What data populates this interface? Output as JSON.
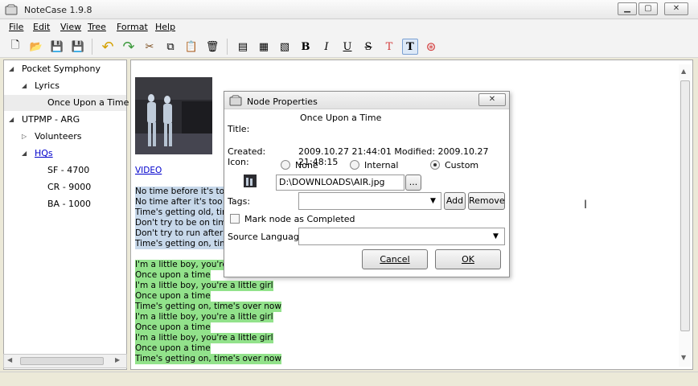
{
  "window": {
    "title": "NoteCase 1.9.8",
    "controls": {
      "minimize": "▁",
      "maximize": "▢",
      "close": "✕"
    }
  },
  "menubar": {
    "items": [
      {
        "label": "File"
      },
      {
        "label": "Edit"
      },
      {
        "label": "View"
      },
      {
        "label": "Tree"
      },
      {
        "label": "Format"
      },
      {
        "label": "Help"
      }
    ]
  },
  "toolbar": {
    "buttons": [
      {
        "icon": "new-document-icon",
        "glyph": "🗋"
      },
      {
        "icon": "open-folder-icon",
        "glyph": "📂"
      },
      {
        "icon": "save-icon",
        "glyph": "💾"
      },
      {
        "icon": "save-as-icon",
        "glyph": "💾"
      },
      {
        "icon": "undo-icon",
        "glyph": "↶"
      },
      {
        "icon": "redo-icon",
        "glyph": "↷"
      },
      {
        "icon": "cut-icon",
        "glyph": "✂"
      },
      {
        "icon": "copy-icon",
        "glyph": "⧉"
      },
      {
        "icon": "paste-icon",
        "glyph": "📋"
      },
      {
        "icon": "delete-icon",
        "glyph": "🗑"
      },
      {
        "icon": "insert-node-icon",
        "glyph": "▤"
      },
      {
        "icon": "insert-child-node-icon",
        "glyph": "▦"
      },
      {
        "icon": "delete-node-icon",
        "glyph": "▧"
      },
      {
        "icon": "bold-icon",
        "glyph": "B"
      },
      {
        "icon": "italic-icon",
        "glyph": "I"
      },
      {
        "icon": "underline-icon",
        "glyph": "U"
      },
      {
        "icon": "strikethrough-icon",
        "glyph": "S"
      },
      {
        "icon": "text-color-icon",
        "glyph": "T"
      },
      {
        "icon": "text-background-icon",
        "glyph": "T"
      },
      {
        "icon": "help-icon",
        "glyph": "⊛"
      }
    ],
    "colors": {
      "text_color": "#d33a3a",
      "text_background": "#1a1a1a"
    }
  },
  "tree": {
    "nodes": [
      {
        "label": "Pocket Symphony",
        "expander": "◢"
      },
      {
        "label": "Lyrics",
        "expander": "◢"
      },
      {
        "label": "Once Upon a Time",
        "expander": ""
      },
      {
        "label": "UTPMP - ARG",
        "expander": "◢"
      },
      {
        "label": "Volunteers",
        "expander": "▷"
      },
      {
        "label": "HQs",
        "expander": "◢"
      },
      {
        "label": "SF - 4700",
        "expander": ""
      },
      {
        "label": "CR - 9000",
        "expander": ""
      },
      {
        "label": "BA - 1000",
        "expander": ""
      }
    ],
    "selected_index": 2
  },
  "editor": {
    "link": "VIDEO",
    "blue_lines": [
      "No time before it's too",
      "No time after it's too la",
      "Time's getting old, time",
      "Don't try to be on time",
      "Don't try to run after ti",
      "Time's getting on, time'"
    ],
    "green_lines": [
      "I'm a little boy, you're a",
      "Once upon a time",
      "I'm a little boy, you're a little girl",
      "Once upon a time",
      "Time's getting on, time's over now",
      "I'm a little boy, you're a little girl",
      "Once upon a time",
      "I'm a little boy, you're a little girl",
      "Once upon a time",
      "Time's getting on, time's over now"
    ]
  },
  "dialog": {
    "title": "Node Properties",
    "close_glyph": "✕",
    "title_label": "Title:",
    "title_value": "Once Upon a Time",
    "created_label": "Created:",
    "created_value": "2009.10.27 21:44:01 Modified: 2009.10.27 21:48:15",
    "icon_label": "Icon:",
    "icon_options": [
      {
        "label": "None",
        "selected": false
      },
      {
        "label": "Internal",
        "selected": false
      },
      {
        "label": "Custom",
        "selected": true
      }
    ],
    "icon_path": "D:\\DOWNLOADS\\AIR.jpg",
    "browse_label": "...",
    "tags_label": "Tags:",
    "tags_value": "",
    "add_label": "Add",
    "remove_label": "Remove",
    "completed_label": "Mark node as Completed",
    "completed_checked": false,
    "source_language_label": "Source Language:",
    "source_language_value": "",
    "cancel_label": "Cancel",
    "ok_label": "OK"
  }
}
